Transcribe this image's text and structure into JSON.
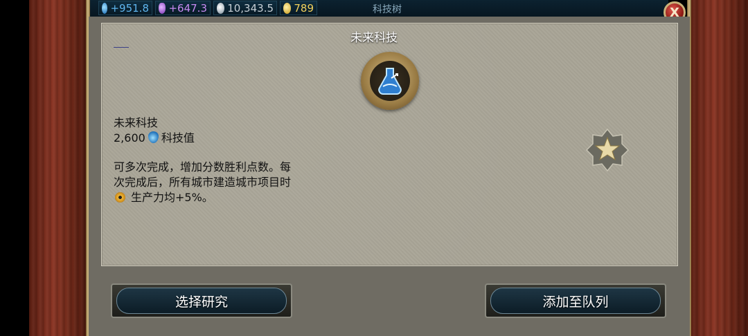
{
  "resources": {
    "science": "+951.8",
    "faith": "+647.3",
    "culture": "10,343.5",
    "gold": "789"
  },
  "topbar": {
    "title": "科技树"
  },
  "close_label": "X",
  "panel": {
    "title": "未来科技",
    "tech_name": "未来科技",
    "cost_value": "2,600",
    "cost_unit": "科技值",
    "description_line1": "可多次完成，增加分数胜利点数。每",
    "description_line2": "次完成后，所有城市建造城市项目时",
    "description_line3": "生产力均+5%。"
  },
  "buttons": {
    "select_research": "选择研究",
    "add_to_queue": "添加至队列"
  },
  "colors": {
    "science": "#5fb6ef",
    "faith": "#c78af2",
    "culture": "#c6cfd6",
    "gold": "#f2d15c"
  }
}
